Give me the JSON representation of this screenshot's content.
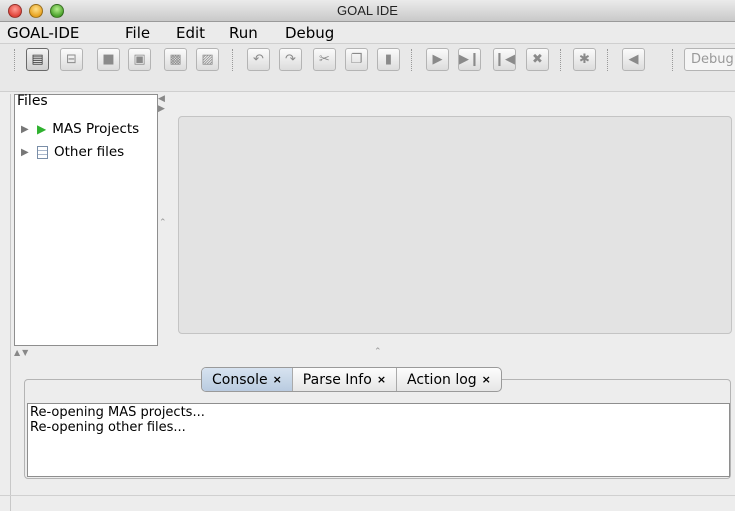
{
  "window": {
    "title": "GOAL IDE"
  },
  "menu": [
    "GOAL-IDE",
    "File",
    "Edit",
    "Run",
    "Debug"
  ],
  "toolbar": {
    "buttons": [
      {
        "name": "new-file-icon",
        "glyph": "▤"
      },
      {
        "name": "open-folder-icon",
        "glyph": "⊟"
      },
      {
        "name": "save-icon",
        "glyph": "■"
      },
      {
        "name": "save-all-icon",
        "glyph": "▣"
      },
      {
        "name": "save-as-icon",
        "glyph": "▩"
      },
      {
        "name": "edit-icon",
        "glyph": "▨"
      },
      {
        "name": "undo-icon",
        "glyph": "↶"
      },
      {
        "name": "redo-icon",
        "glyph": "↷"
      },
      {
        "name": "cut-icon",
        "glyph": "✂"
      },
      {
        "name": "copy-icon",
        "glyph": "❐"
      },
      {
        "name": "paste-icon",
        "glyph": "▮"
      },
      {
        "name": "play-icon",
        "glyph": "▶"
      },
      {
        "name": "step-icon",
        "glyph": "▶❙"
      },
      {
        "name": "pause-icon",
        "glyph": "❙◀"
      },
      {
        "name": "kill-icon",
        "glyph": "✖"
      },
      {
        "name": "debug-bug-icon",
        "glyph": "✱"
      },
      {
        "name": "back-icon",
        "glyph": "◀"
      }
    ],
    "debug_label": "Debug"
  },
  "files": {
    "header": "Files",
    "items": [
      {
        "label": "MAS Projects",
        "icon": "green-play-icon"
      },
      {
        "label": "Other files",
        "icon": "document-icon"
      }
    ]
  },
  "tabs": [
    {
      "label": "Console",
      "active": true
    },
    {
      "label": "Parse Info",
      "active": false
    },
    {
      "label": "Action log",
      "active": false
    }
  ],
  "tab_close": "×",
  "console": {
    "lines": [
      "Re-opening MAS projects...",
      "Re-opening other files..."
    ]
  }
}
